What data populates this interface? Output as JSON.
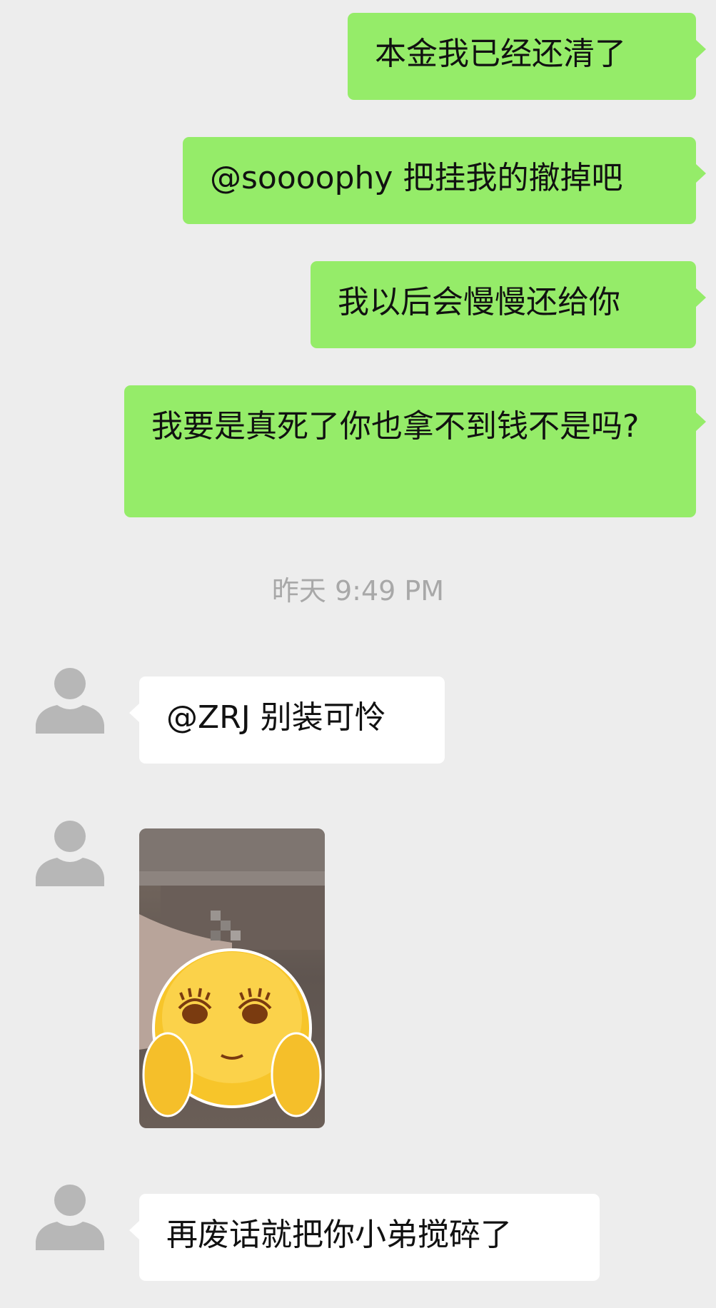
{
  "chat": {
    "messages_out": [
      {
        "text": "本金我已经还清了"
      },
      {
        "text": "@soooophy 把挂我的撤掉吧"
      },
      {
        "text": "我以后会慢慢还给你"
      },
      {
        "text": "我要是真死了你也拿不到钱不是吗?"
      }
    ],
    "timestamp": "昨天 9:49 PM",
    "messages_in": [
      {
        "text": "@ZRJ 别装可怜"
      },
      {
        "text": "再废话就把你小弟搅碎了"
      }
    ],
    "sticker": {
      "icon": "smiling-face-sticker"
    }
  },
  "colors": {
    "background": "#ededed",
    "outgoing_bubble": "#95ec69",
    "incoming_bubble": "#ffffff",
    "timestamp_text": "#a8a8a8"
  }
}
